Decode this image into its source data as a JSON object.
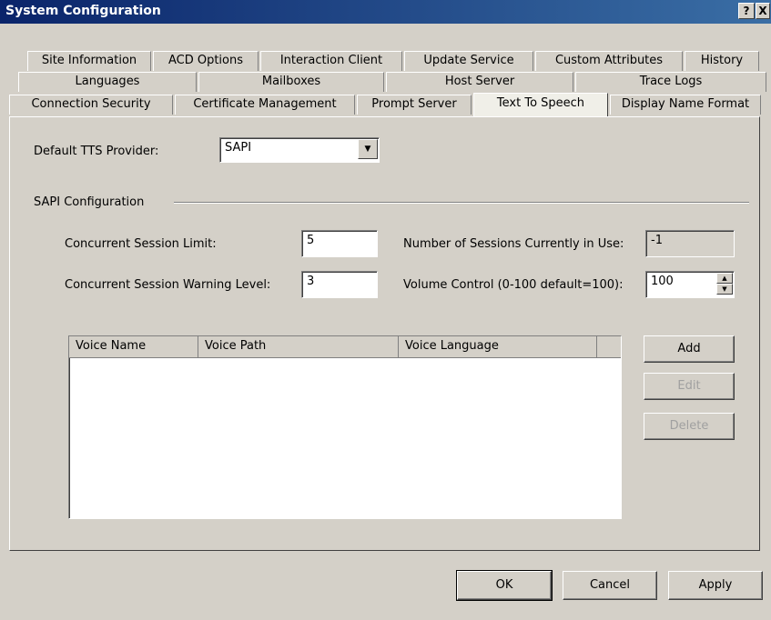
{
  "window": {
    "title": "System Configuration",
    "help_glyph": "?",
    "close_glyph": "X"
  },
  "tabs": {
    "row1": [
      "Site Information",
      "ACD Options",
      "Interaction Client",
      "Update Service",
      "Custom Attributes",
      "History"
    ],
    "row2": [
      "Languages",
      "Mailboxes",
      "Host Server",
      "Trace Logs"
    ],
    "row3": [
      "Connection Security",
      "Certificate Management",
      "Prompt Server",
      "Text To Speech",
      "Display Name Format"
    ],
    "active": "Text To Speech"
  },
  "tts": {
    "provider_label": "Default TTS Provider:",
    "provider_value": "SAPI",
    "dropdown_arrow": "▼",
    "sapi_group": "SAPI Configuration",
    "session_limit_label": "Concurrent Session Limit:",
    "session_limit_value": "5",
    "warning_level_label": "Concurrent Session Warning Level:",
    "warning_level_value": "3",
    "sessions_in_use_label": "Number of Sessions Currently in Use:",
    "sessions_in_use_value": "-1",
    "volume_label": "Volume Control (0-100 default=100):",
    "volume_value": "100",
    "spin_up": "▲",
    "spin_down": "▼"
  },
  "voices": {
    "columns": [
      "Voice Name",
      "Voice Path",
      "Voice Language"
    ],
    "rows": []
  },
  "voice_buttons": {
    "add": "Add",
    "edit": "Edit",
    "delete": "Delete"
  },
  "footer": {
    "ok": "OK",
    "cancel": "Cancel",
    "apply": "Apply"
  }
}
